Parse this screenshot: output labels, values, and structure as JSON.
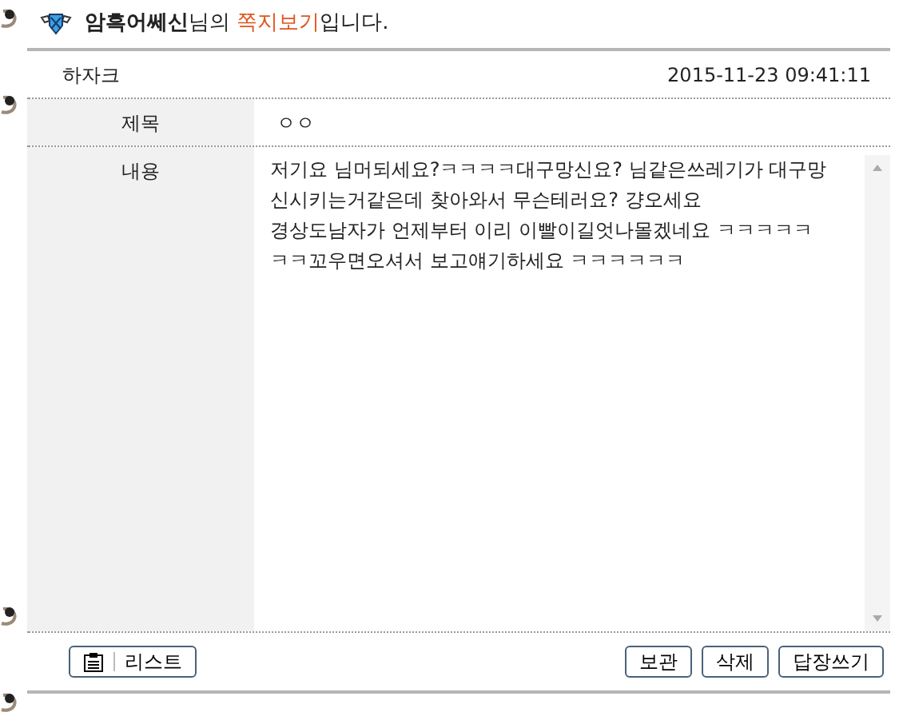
{
  "header": {
    "name": "암흑어쎄신",
    "middle": "님의 ",
    "highlight": "쪽지보기",
    "tail": "입니다."
  },
  "sender": {
    "name": "하자크",
    "datetime": "2015-11-23 09:41:11"
  },
  "fields": [
    {
      "label": "제목",
      "value": "ㅇㅇ"
    }
  ],
  "message": {
    "label": "내용",
    "lines": [
      "저기요 님머되세요?ㅋㅋㅋㅋ대구망신요? 님같은쓰레기가 대구망",
      "신시키는거같은데 찾아와서 무슨테러요? 걍오세요",
      "경상도남자가 언제부터 이리 이빨이길엇나몰겠네요 ㅋㅋㅋㅋㅋ",
      "ㅋㅋ꼬우면오셔서 보고얘기하세요 ㅋㅋㅋㅋㅋㅋ"
    ]
  },
  "list_button": "리스트",
  "buttons": [
    "보관",
    "삭제",
    "답장쓰기"
  ]
}
